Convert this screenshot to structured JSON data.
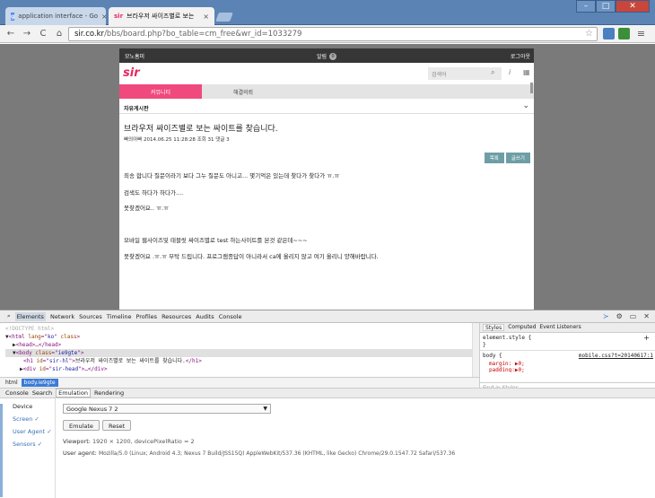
{
  "tabs": [
    {
      "title": "application interface - Go",
      "favicon": "g",
      "active": false
    },
    {
      "title": "브라우저 싸이즈별로 보는",
      "favicon": "sir",
      "active": true
    }
  ],
  "window": {
    "minimize": "–",
    "maximize": "□",
    "close": "✕"
  },
  "toolbar": {
    "back": "←",
    "forward": "→",
    "reload": "C",
    "home": "⌂",
    "url_domain": "sir.co.kr",
    "url_path": "/bbs/board.php?bo_table=cm_free&wr_id=1033279"
  },
  "site": {
    "header": {
      "home": "모노홈미",
      "alarm": "알림",
      "alarm_count": "0",
      "login": "로그아웃"
    },
    "logo": "sir",
    "search_placeholder": "검색어",
    "nav": [
      "커뮤니티",
      "해결의뢰"
    ],
    "board_name": "자유게시판",
    "post": {
      "title": "브라우저 싸이즈별로 보는 싸이트를 찾습니다.",
      "meta": "빠의아빠   2014.06.25 11:28:28   조회 31   댓글 3",
      "btn_list": "목록",
      "btn_write": "글쓰기",
      "lines": [
        "죄송 합니다 질문이라기 보다 그누 질문도 아니고... 몇기억은 있는데 찾다가 찾다가 ㅠ.ㅠ",
        "검색도 하다가 하다가....",
        "못찾겠어요.. ㅠ.ㅠ",
        "모바일 웹사이즈및 태블릿 싸이즈별로 test 하는사이트를 본것 같은데~~~",
        "못찾겠어요 .ㅠ.ㅠ 부탁 드립니다. 프로그램종답이 아니라서 ca에 올리지 않고 여기 올리니 양해바랍니다."
      ]
    }
  },
  "devtools": {
    "tabs": [
      "Elements",
      "Network",
      "Sources",
      "Timeline",
      "Profiles",
      "Resources",
      "Audits",
      "Console"
    ],
    "active_tab": "Elements",
    "dom": {
      "doctype": "<!DOCTYPE html>",
      "html_open": "html",
      "html_lang": "ko",
      "html_class": "class",
      "head": "<head>…</head>",
      "body_class": "ie9gte",
      "h1_id": "sir-hl",
      "h1_text": "브라우저 싸이즈별로 보는 싸이트를 찾습니다.",
      "div_id": "sir-head",
      "div_text": "…</div>"
    },
    "styles_tabs": [
      "Styles",
      "Computed",
      "Event Listeners"
    ],
    "styles": {
      "element_style": "element.style {",
      "close_brace": "}",
      "body_sel": "body {",
      "body_link": "mobile.css?t=20140617:1",
      "margin": "margin: ▶0;",
      "padding": "padding:▶0;",
      "find": "Find in Styles"
    },
    "crumbs": [
      "html",
      "body.ie9gte"
    ],
    "drawer_tabs": [
      "Console",
      "Search",
      "Emulation",
      "Rendering"
    ],
    "emulation": {
      "side": {
        "device": "Device",
        "screen": "Screen ✓",
        "user_agent": "User Agent ✓",
        "sensors": "Sensors ✓"
      },
      "device_select": "Google Nexus 7 2",
      "emulate": "Emulate",
      "reset": "Reset",
      "viewport_label": "Viewport:",
      "viewport_value": "1920 × 1200, devicePixelRatio = 2",
      "ua_label": "User agent:",
      "ua_value": "Mozilla/5.0 (Linux; Android 4.3; Nexus 7 Build/JSS15Q) AppleWebKit/537.36 (KHTML, like Gecko) Chrome/29.0.1547.72 Safari/537.36"
    }
  }
}
